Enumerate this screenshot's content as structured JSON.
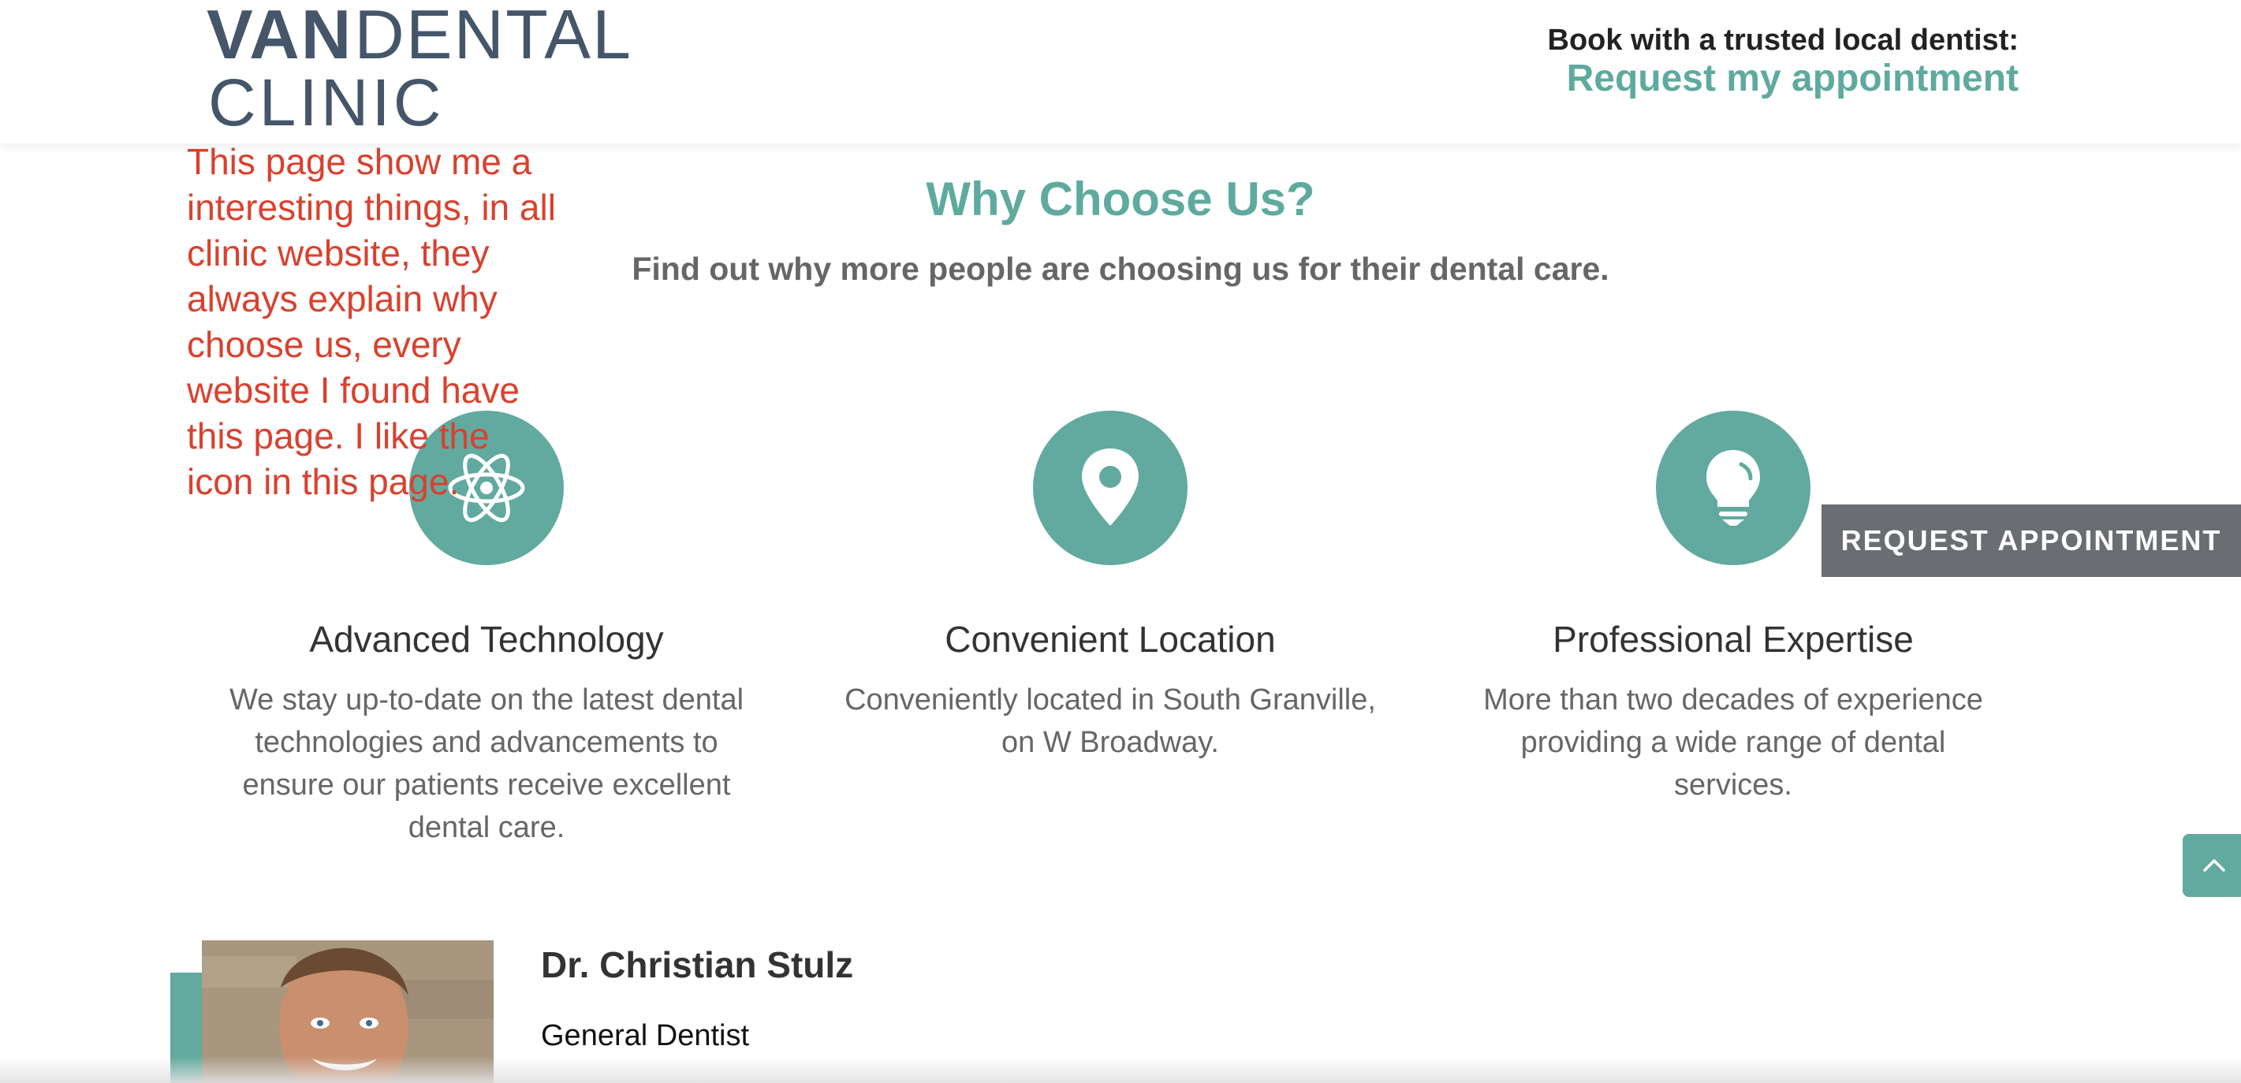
{
  "header": {
    "logo_van": "VAN",
    "logo_dental": "DENTAL",
    "logo_clinic": "CLINIC",
    "book_tagline": "Book with a trusted local dentist:",
    "book_link": "Request my appointment"
  },
  "section": {
    "title": "Why Choose Us?",
    "subtitle": "Find out why more people are choosing us for their dental care."
  },
  "features": [
    {
      "icon": "atom-icon",
      "title": "Advanced Technology",
      "description": "We stay up-to-date on the latest dental technologies and advancements to ensure our patients receive excellent dental care."
    },
    {
      "icon": "location-pin-icon",
      "title": "Convenient Location",
      "description": "Conveniently located in South Granville, on W Broadway."
    },
    {
      "icon": "lightbulb-icon",
      "title": "Professional Expertise",
      "description": "More than two decades of experience providing a wide range of dental services."
    }
  ],
  "annotation": {
    "text": "This page show me a interesting things, in all clinic website, they always explain why choose us, every website I found have this page. I like the icon in this page."
  },
  "floating": {
    "request_button": "REQUEST APPOINTMENT",
    "scroll_top_icon": "chevron-up-icon"
  },
  "dentist": {
    "name": "Dr. Christian Stulz",
    "role": "General Dentist"
  },
  "colors": {
    "accent": "#5faa9e",
    "logo": "#45566a",
    "annotation": "#d9412e",
    "button_gray": "#6a6d72"
  }
}
